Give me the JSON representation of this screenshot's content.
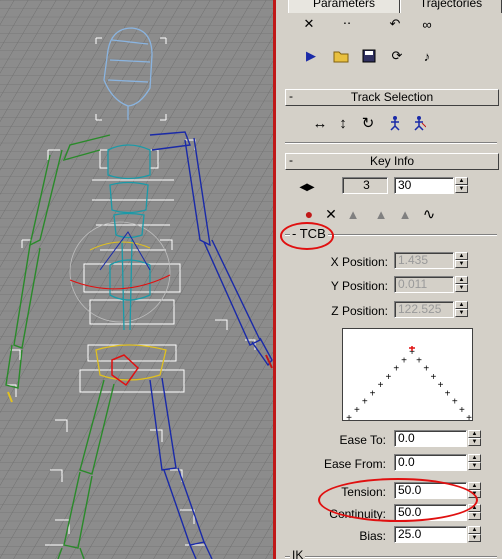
{
  "tabs": {
    "parameters": "Parameters",
    "trajectories": "Trajectories"
  },
  "track_selection": {
    "title": "Track Selection",
    "pm": "-"
  },
  "key_info": {
    "title": "Key Info",
    "pm": "-",
    "key_number": "3",
    "time_value": "30",
    "tcb_label": "TCB",
    "tcb_pm": "-",
    "x_label": "X Position:",
    "x_value": "1.435",
    "y_label": "Y Position:",
    "y_value": "0.011",
    "z_label": "Z Position:",
    "z_value": "122.525",
    "ease_to_label": "Ease To:",
    "ease_to_value": "0.0",
    "ease_from_label": "Ease From:",
    "ease_from_value": "0.0",
    "tension_label": "Tension:",
    "tension_value": "50.0",
    "continuity_label": "Continuity:",
    "continuity_value": "50.0",
    "bias_label": "Bias:",
    "bias_value": "25.0",
    "ik_label": "IK"
  },
  "colors": {
    "viewport_bg": "#8c8c8c",
    "panel_bg": "#d4d0c8",
    "highlight": "#e01010",
    "left_limbs": "#2a8a2a",
    "right_limbs": "#1a2aa8",
    "spine": "#1a9aa8",
    "head": "#8ab4e0"
  }
}
